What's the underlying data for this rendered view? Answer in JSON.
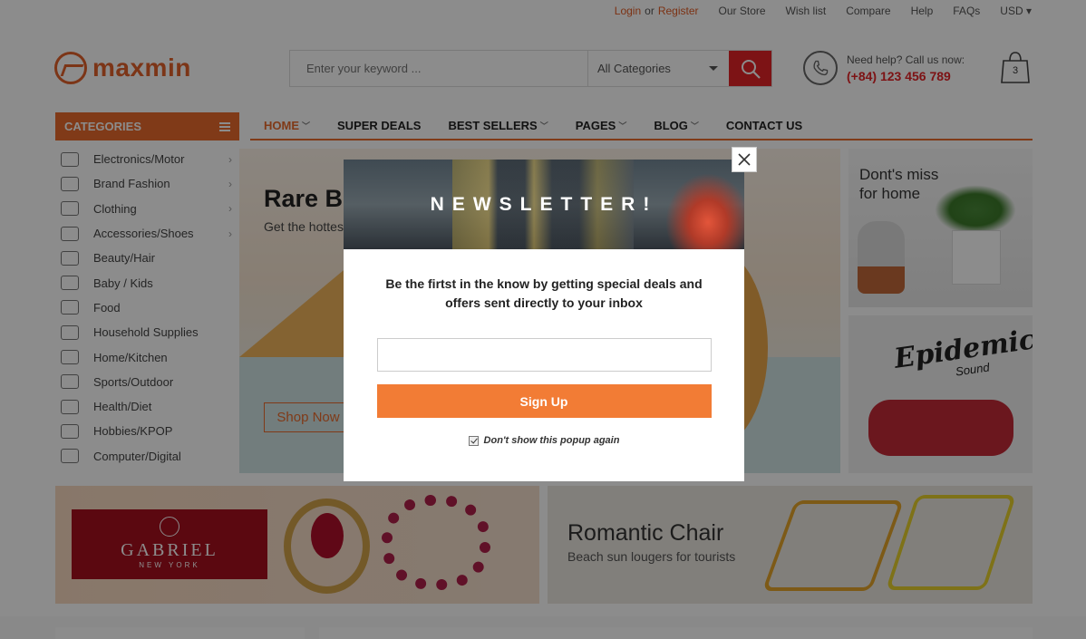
{
  "topbar": {
    "login": "Login",
    "or": "or",
    "register": "Register",
    "our_store": "Our Store",
    "wish_list": "Wish list",
    "compare": "Compare",
    "help": "Help",
    "faqs": "FAQs",
    "currency": "USD"
  },
  "header": {
    "logo": "maxmin",
    "search_placeholder": "Enter your keyword ...",
    "category_select": "All Categories",
    "help_line": "Need help? Call us now:",
    "phone": "(+84) 123 456 789",
    "cart_count": "3"
  },
  "nav": {
    "categories_label": "CATEGORIES",
    "items": [
      {
        "label": "HOME",
        "dropdown": true
      },
      {
        "label": "SUPER DEALS",
        "dropdown": false
      },
      {
        "label": "BEST SELLERS",
        "dropdown": true
      },
      {
        "label": "PAGES",
        "dropdown": true
      },
      {
        "label": "BLOG",
        "dropdown": true
      },
      {
        "label": "CONTACT US",
        "dropdown": false
      }
    ]
  },
  "sidebar": {
    "items": [
      {
        "label": "Electronics/Motor",
        "has_sub": true
      },
      {
        "label": "Brand Fashion",
        "has_sub": true
      },
      {
        "label": "Clothing",
        "has_sub": true
      },
      {
        "label": "Accessories/Shoes",
        "has_sub": true
      },
      {
        "label": "Beauty/Hair",
        "has_sub": false
      },
      {
        "label": "Baby / Kids",
        "has_sub": false
      },
      {
        "label": "Food",
        "has_sub": false
      },
      {
        "label": "Household Supplies",
        "has_sub": false
      },
      {
        "label": "Home/Kitchen",
        "has_sub": false
      },
      {
        "label": "Sports/Outdoor",
        "has_sub": false
      },
      {
        "label": "Health/Diet",
        "has_sub": false
      },
      {
        "label": "Hobbies/KPOP",
        "has_sub": false
      },
      {
        "label": "Computer/Digital",
        "has_sub": false
      }
    ]
  },
  "hero": {
    "title": "Rare Be",
    "subtitle": "Get the hottes",
    "button": "Shop Now"
  },
  "side_banners": {
    "home_title_1": "Dont's miss",
    "home_title_2": "for home",
    "brand": "Epidemic",
    "brand_sub": "Sound"
  },
  "bottom_banners": {
    "gabriel_name": "GABRIEL",
    "gabriel_city": "NEW YORK",
    "chair_title": "Romantic Chair",
    "chair_sub": "Beach sun lougers for tourists"
  },
  "modal": {
    "title": "NEWSLETTER!",
    "text": "Be the firtst in the know by getting special deals and offers sent directly to your inbox",
    "email_value": "",
    "signup": "Sign Up",
    "checkbox_label": "Don't show this popup again",
    "checkbox_checked": true
  },
  "colors": {
    "accent": "#e96b2c",
    "search_button": "#e42427",
    "signup_button": "#f27c35"
  }
}
